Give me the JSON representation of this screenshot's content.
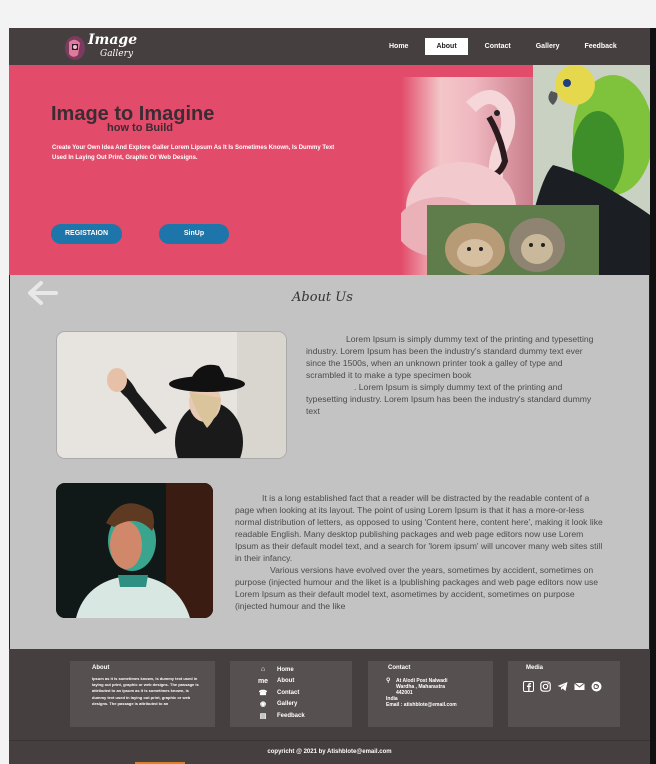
{
  "app": {
    "logo_line1": "Image",
    "logo_line2": "Gallery"
  },
  "nav": {
    "items": [
      {
        "label": "Home",
        "active": false
      },
      {
        "label": "About",
        "active": true
      },
      {
        "label": "Contact",
        "active": false
      },
      {
        "label": "Gallery",
        "active": false
      },
      {
        "label": "Feedback",
        "active": false
      }
    ]
  },
  "hero": {
    "title": "Image to Imagine",
    "subtitle": "how to Build",
    "description": "Create Your Own Idea And Explore Galler  Lorem  Lipsum As It Is Sometimes Known, Is Dummy Text Used In Laying Out Print, Graphic Or Web Designs.",
    "register_label": "REGISTAION",
    "signup_label": "SinUp",
    "accent_color": "#e24b6a",
    "button_color": "#1d75aa"
  },
  "about": {
    "title": "About Us",
    "para1_a": "Lorem Ipsum is simply dummy text of the printing and typesetting industry. Lorem Ipsum has been the industry's standard dummy text ever since the 1500s, when an unknown printer took a galley of type and scrambled it to make a type specimen book",
    "para1_b": ". Lorem Ipsum is simply dummy text of the printing and typesetting industry. Lorem Ipsum has been the industry's standard dummy text",
    "para2_a": "It is a long established fact that a reader will be distracted by the readable content of a page when looking at its layout. The point of using Lorem Ipsum is that it has a more-or-less normal distribution of letters, as opposed to using 'Content here, content here', making it look like readable English. Many desktop publishing packages and web page editors now use Lorem Ipsum as their default model text, and a search for 'lorem ipsum' will uncover many web sites still in their infancy.",
    "para2_b": "Various versions have evolved over the years, sometimes by accident, sometimes on purpose (injected humour and the liket is a lpublishing packages and web page editors now use Lorem Ipsum as their default model text, asometimes by accident, sometimes on purpose (injected humour and the like"
  },
  "footer": {
    "about_heading": "About",
    "about_text": "Ipsum as it is sometimes known, is dummy text used in laying out print, graphic or web designs. The passage is attributed to an Ipsum as it is sometimes known, is dummy text used in laying out print, graphic or web designs. The passage is attributed to an",
    "links": [
      {
        "icon": "home-icon",
        "glyph": "⌂",
        "label": "Home"
      },
      {
        "icon": "me-icon",
        "glyph": "me",
        "label": "About"
      },
      {
        "icon": "contact-icon",
        "glyph": "☎",
        "label": "Contact"
      },
      {
        "icon": "gallery-icon",
        "glyph": "◉",
        "label": "Gallery"
      },
      {
        "icon": "feedback-icon",
        "glyph": "▤",
        "label": "Feedback"
      }
    ],
    "contact_heading": "Contact",
    "contact_lines": [
      "At Alodi Post Nalwadi",
      "Wardha , Maharastra",
      "442001",
      "India",
      "Email : atishblote@email.com"
    ],
    "media_heading": "Media",
    "media_icons": [
      "facebook-icon",
      "instagram-icon",
      "telegram-icon",
      "mail-icon",
      "google-plus-icon"
    ],
    "copyright": "copyricht @ 2021 by Atishblote@email.com"
  }
}
